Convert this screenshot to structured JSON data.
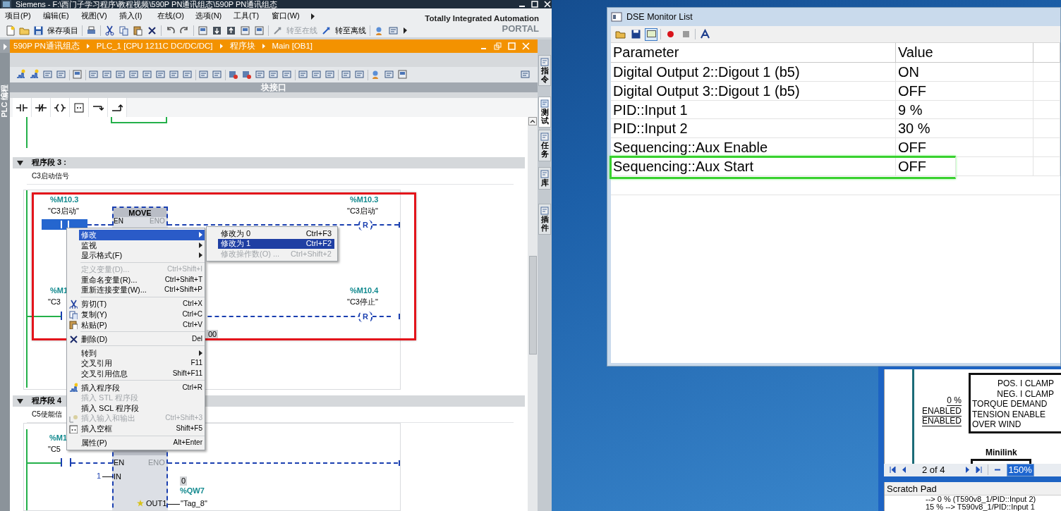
{
  "tia_window": {
    "title": "Siemens  -  F:\\西门子学习程序\\教程视频\\590P PN通讯组态\\590P PN通讯组态",
    "menu": [
      "项目(P)",
      "编辑(E)",
      "视图(V)",
      "插入(I)",
      "在线(O)",
      "选项(N)",
      "工具(T)",
      "窗口(W)"
    ],
    "toolbar_buttons": [
      {
        "label": "保存项目",
        "disabled": false
      },
      {
        "label": "转至在线",
        "disabled": true
      },
      {
        "label": "转至离线",
        "disabled": false
      }
    ],
    "portal": {
      "line1": "Totally Integrated Automation",
      "line2": "PORTAL"
    },
    "breadcrumb": [
      "590P PN通讯组态",
      "PLC_1 [CPU 1211C DC/DC/DC]",
      "程序块",
      "Main [OB1]"
    ],
    "side_panel_label": "PLC 编程",
    "block_interface": "块接口",
    "right_tabs": [
      {
        "label": "指令",
        "selected": false
      },
      {
        "label": "测试",
        "selected": true
      },
      {
        "label": "任务",
        "selected": false
      },
      {
        "label": "库",
        "selected": false
      },
      {
        "label": "插件",
        "selected": false
      }
    ]
  },
  "networks": [
    {
      "title": "程序段 3 :",
      "expanded": true,
      "comment": "C3启动信号",
      "contacts": [
        {
          "address": "%M10.3",
          "tag": "\"C3启动\"",
          "selected": true
        },
        {
          "address": "%M1",
          "tag": "\"C3",
          "selected": false
        }
      ],
      "move_block": {
        "title": "MOVE",
        "en": "EN",
        "eno": "ENO"
      },
      "coils": [
        {
          "address": "%M10.3",
          "tag": "\"C3启动\"",
          "symbol": "R"
        },
        {
          "address": "%M10.4",
          "tag": "\"C3停止\"",
          "symbol": "R"
        }
      ],
      "value_box": "00"
    },
    {
      "title": "程序段 4",
      "expanded": true,
      "comment": "C5使能信",
      "contacts": [
        {
          "address": "%M1",
          "tag": "\"C5",
          "selected": false
        }
      ],
      "move_block": {
        "en": "EN",
        "eno": "ENO",
        "in": "IN",
        "in_value": "1",
        "out": "OUT1",
        "out_value": "0",
        "out_address": "%QW7",
        "out_tag": "\"Tag_8\""
      }
    }
  ],
  "context_menu": {
    "items": [
      {
        "kind": "item",
        "label": "修改",
        "submenu": true,
        "disabled": false,
        "selected": true
      },
      {
        "kind": "item",
        "label": "监视",
        "submenu": true,
        "disabled": false,
        "selected": false
      },
      {
        "kind": "item",
        "label": "显示格式(F)",
        "submenu": true,
        "disabled": false,
        "selected": false
      },
      {
        "kind": "separator"
      },
      {
        "kind": "item",
        "label": "定义变量(D)...",
        "shortcut": "Ctrl+Shift+I",
        "submenu": false,
        "disabled": true,
        "selected": false
      },
      {
        "kind": "item",
        "label": "重命名变量(R)...",
        "shortcut": "Ctrl+Shift+T",
        "submenu": false,
        "disabled": false,
        "selected": false
      },
      {
        "kind": "item",
        "label": "重新连接变量(W)...",
        "shortcut": "Ctrl+Shift+P",
        "submenu": false,
        "disabled": false,
        "selected": false
      },
      {
        "kind": "separator"
      },
      {
        "kind": "item",
        "label": "剪切(T)",
        "shortcut": "Ctrl+X",
        "submenu": false,
        "disabled": false,
        "selected": false
      },
      {
        "kind": "item",
        "label": "复制(Y)",
        "shortcut": "Ctrl+C",
        "submenu": false,
        "disabled": false,
        "selected": false
      },
      {
        "kind": "item",
        "label": "粘贴(P)",
        "shortcut": "Ctrl+V",
        "submenu": false,
        "disabled": false,
        "selected": false
      },
      {
        "kind": "separator"
      },
      {
        "kind": "item",
        "label": "删除(D)",
        "shortcut": "Del",
        "submenu": false,
        "disabled": false,
        "selected": false
      },
      {
        "kind": "separator"
      },
      {
        "kind": "item",
        "label": "转到",
        "submenu": true,
        "disabled": false,
        "selected": false
      },
      {
        "kind": "item",
        "label": "交叉引用",
        "shortcut": "F11",
        "submenu": false,
        "disabled": false,
        "selected": false
      },
      {
        "kind": "item",
        "label": "交叉引用信息",
        "shortcut": "Shift+F11",
        "submenu": false,
        "disabled": false,
        "selected": false
      },
      {
        "kind": "separator"
      },
      {
        "kind": "item",
        "label": "插入程序段",
        "shortcut": "Ctrl+R",
        "submenu": false,
        "disabled": false,
        "selected": false
      },
      {
        "kind": "item",
        "label": "插入 STL 程序段",
        "submenu": false,
        "disabled": true,
        "selected": false
      },
      {
        "kind": "item",
        "label": "插入 SCL 程序段",
        "submenu": false,
        "disabled": false,
        "selected": false
      },
      {
        "kind": "item",
        "label": "插入输入和输出",
        "shortcut": "Ctrl+Shift+3",
        "submenu": false,
        "disabled": true,
        "selected": false
      },
      {
        "kind": "item",
        "label": "插入空框",
        "shortcut": "Shift+F5",
        "submenu": false,
        "disabled": false,
        "selected": false
      },
      {
        "kind": "separator"
      },
      {
        "kind": "item",
        "label": "属性(P)",
        "shortcut": "Alt+Enter",
        "submenu": false,
        "disabled": false,
        "selected": false
      }
    ],
    "submenu": [
      {
        "label": "修改为 0",
        "shortcut": "Ctrl+F3",
        "disabled": false,
        "selected": false
      },
      {
        "label": "修改为 1",
        "shortcut": "Ctrl+F2",
        "disabled": false,
        "selected": true
      },
      {
        "label": "修改操作数(O) ...",
        "shortcut": "Ctrl+Shift+2",
        "disabled": true,
        "selected": false
      }
    ]
  },
  "monitor_window": {
    "title": "DSE Monitor List",
    "columns": [
      "Parameter",
      "Value"
    ],
    "rows": [
      {
        "parameter": "Digital Output 2::Digout 1 (b5)",
        "value": "ON",
        "highlighted": false
      },
      {
        "parameter": "Digital Output 3::Digout 1 (b5)",
        "value": "OFF",
        "highlighted": false
      },
      {
        "parameter": "PID::Input 1",
        "value": "9 %",
        "highlighted": false
      },
      {
        "parameter": "PID::Input 2",
        "value": "30 %",
        "highlighted": false
      },
      {
        "parameter": "Sequencing::Aux Enable",
        "value": "OFF",
        "highlighted": false
      },
      {
        "parameter": "Sequencing::Aux Start",
        "value": "OFF",
        "highlighted": true
      }
    ]
  },
  "diagram_window": {
    "block_outputs": [
      "POS. I CLAMP",
      "NEG. I CLAMP"
    ],
    "block_inputs": [
      "TORQUE DEMAND",
      "TENSION ENABLE",
      "OVER WIND"
    ],
    "input_values": [
      "0 %",
      "ENABLED",
      "ENABLED"
    ],
    "minilink_title": "Minilink",
    "pager": {
      "page": "2 of 4",
      "zoom": "150%",
      "zoom_selected": true
    },
    "scratch_pad": {
      "title": "Scratch Pad",
      "lines": [
        "--> 0 % (T590v8_1/PID::Input 2)",
        "15 % --> T590v8_1/PID::Input 1"
      ]
    }
  }
}
